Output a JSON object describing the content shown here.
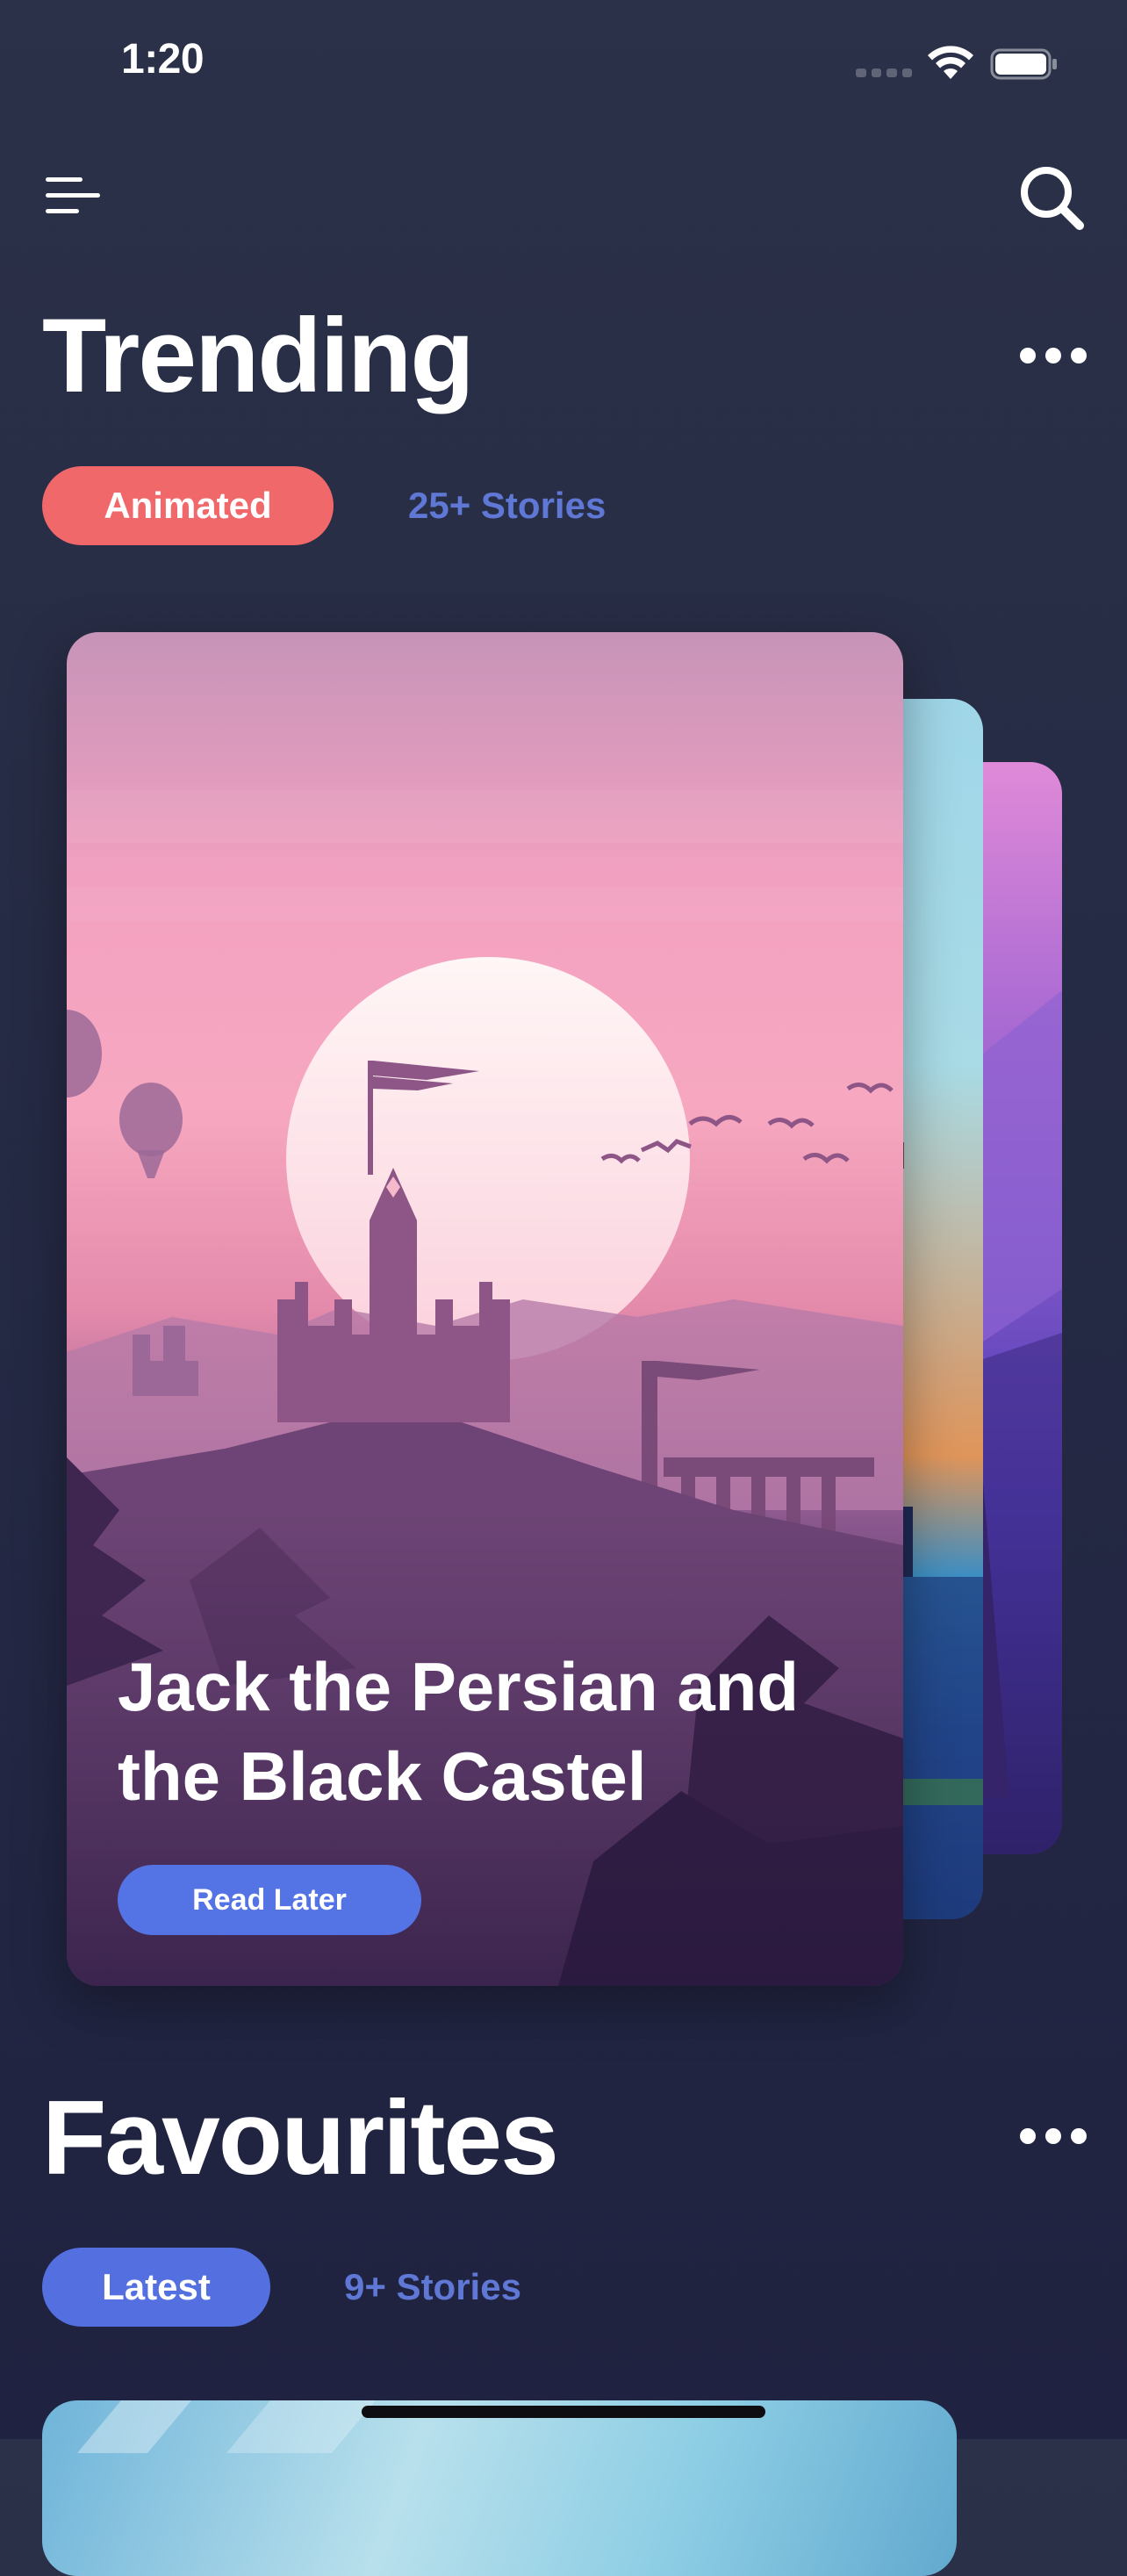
{
  "status_bar": {
    "time": "1:20"
  },
  "icons": {
    "menu": "menu-icon",
    "search": "search-icon",
    "more": "ellipsis-icon",
    "wifi": "wifi-icon",
    "battery": "battery-icon"
  },
  "trending": {
    "title": "Trending",
    "filter_label": "Animated",
    "count_label": "25+ Stories",
    "featured_story": {
      "title": "Jack the Persian and the Black Castel",
      "button_label": "Read Later"
    }
  },
  "favourites": {
    "title": "Favourites",
    "filter_label": "Latest",
    "count_label": "9+ Stories"
  },
  "colors": {
    "background": "#262b45",
    "accent_red": "#f0686a",
    "accent_blue": "#5470e0",
    "count_text": "#5f78d6"
  }
}
